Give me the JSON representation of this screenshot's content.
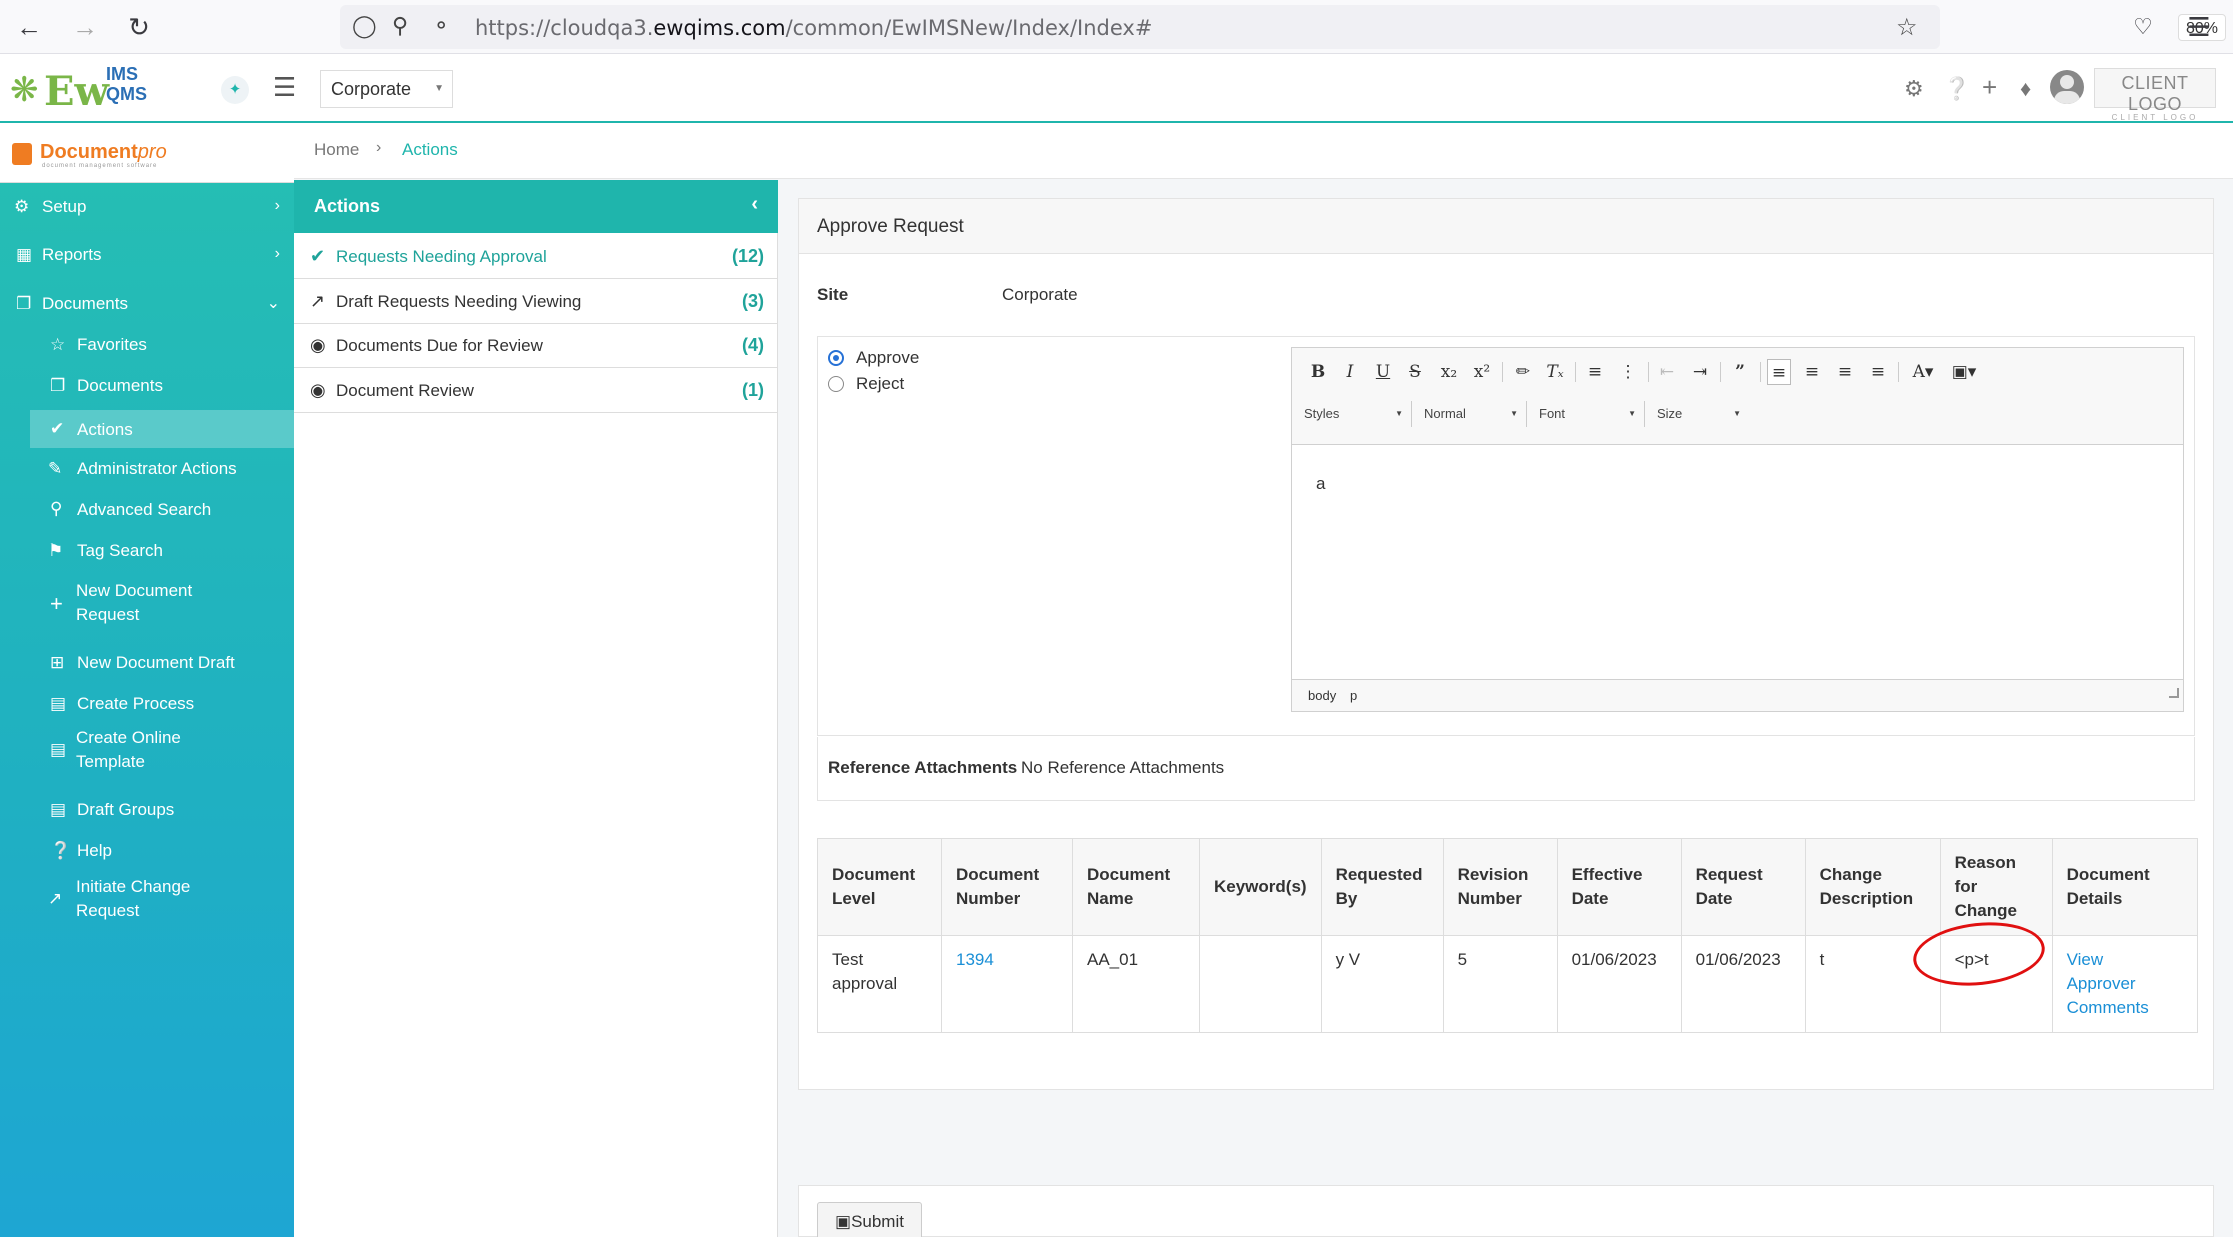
{
  "browser": {
    "url_prefix": "https://cloudqa3.",
    "url_domain": "ewqims.com",
    "url_path": "/common/EwIMSNew/Index/Index#",
    "zoom": "80%"
  },
  "header": {
    "logo_ew": "Ew",
    "logo_ims": "IMS",
    "logo_qms": "QMS",
    "site_selected": "Corporate",
    "client_logo": "CLIENT LOGO",
    "client_logo_sub": "CLIENT LOGO"
  },
  "sidebar": {
    "brand": "Document",
    "brand_italic": "pro",
    "brand_sub": "document management software",
    "items": [
      {
        "label": "Setup"
      },
      {
        "label": "Reports"
      },
      {
        "label": "Documents"
      },
      {
        "label": "Favorites"
      },
      {
        "label": "Documents"
      },
      {
        "label": "Actions"
      },
      {
        "label": "Administrator Actions"
      },
      {
        "label": "Advanced Search"
      },
      {
        "label": "Tag Search"
      },
      {
        "label": "New Document",
        "label2": "Request"
      },
      {
        "label": "New Document Draft"
      },
      {
        "label": "Create Process"
      },
      {
        "label": "Create Online",
        "label2": "Template"
      },
      {
        "label": "Draft Groups"
      },
      {
        "label": "Help"
      },
      {
        "label": "Initiate Change",
        "label2": "Request"
      }
    ]
  },
  "breadcrumb": {
    "home": "Home",
    "current": "Actions"
  },
  "actions": {
    "title": "Actions",
    "items": [
      {
        "label": "Requests Needing Approval",
        "count": "(12)"
      },
      {
        "label": "Draft Requests Needing Viewing",
        "count": "(3)"
      },
      {
        "label": "Documents Due for Review",
        "count": "(4)"
      },
      {
        "label": "Document Review",
        "count": "(1)"
      }
    ]
  },
  "approve": {
    "title": "Approve Request",
    "site_label": "Site",
    "site_value": "Corporate",
    "approve_label": "Approve",
    "reject_label": "Reject",
    "editor": {
      "styles": "Styles",
      "format": "Normal",
      "font": "Font",
      "size": "Size",
      "content": "a",
      "path_body": "body",
      "path_p": "p"
    },
    "ref_label": "Reference Attachments",
    "ref_value": "No Reference Attachments"
  },
  "table": {
    "headers": [
      [
        "Document",
        "Level"
      ],
      [
        "Document",
        "Number"
      ],
      [
        "Document",
        "Name"
      ],
      [
        "Keyword(s)"
      ],
      [
        "Requested",
        "By"
      ],
      [
        "Revision",
        "Number"
      ],
      [
        "Effective",
        "Date"
      ],
      [
        "Request",
        "Date"
      ],
      [
        "Change",
        "Description"
      ],
      [
        "Reason",
        "for",
        "Change"
      ],
      [
        "Document",
        "Details"
      ]
    ],
    "row": {
      "level_1": "Test",
      "level_2": "approval",
      "number": "1394",
      "name": "AA_01",
      "keywords": "",
      "requested_by": "y V",
      "revision": "5",
      "effective_date": "01/06/2023",
      "request_date": "01/06/2023",
      "change_description": "t",
      "reason": "<p>t",
      "details_1": "View",
      "details_2": "Approver",
      "details_3": "Comments"
    }
  },
  "submit_label": "Submit"
}
